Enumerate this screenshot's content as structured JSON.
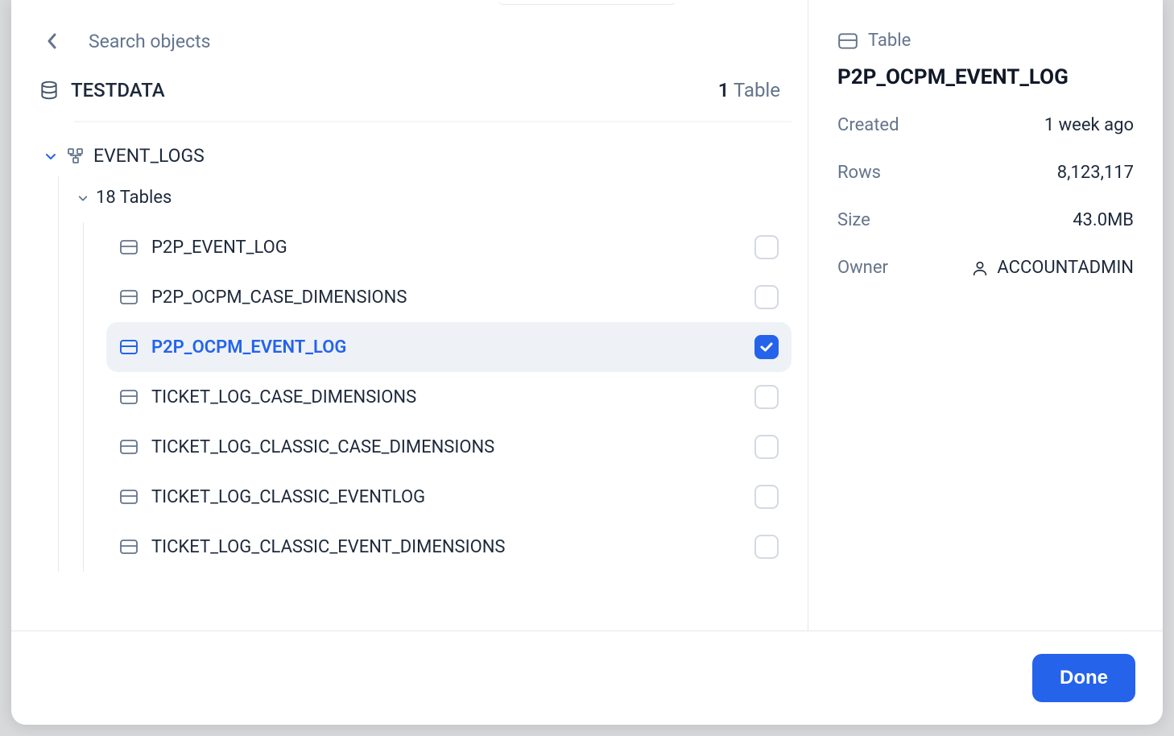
{
  "search": {
    "placeholder": "Search objects"
  },
  "database": {
    "name": "TESTDATA",
    "count_number": "1",
    "count_noun": "Table"
  },
  "schema": {
    "name": "EVENT_LOGS",
    "tables_group_label": "18 Tables"
  },
  "tables": [
    {
      "name": "P2P_EVENT_LOG",
      "selected": false,
      "checked": false
    },
    {
      "name": "P2P_OCPM_CASE_DIMENSIONS",
      "selected": false,
      "checked": false
    },
    {
      "name": "P2P_OCPM_EVENT_LOG",
      "selected": true,
      "checked": true
    },
    {
      "name": "TICKET_LOG_CASE_DIMENSIONS",
      "selected": false,
      "checked": false
    },
    {
      "name": "TICKET_LOG_CLASSIC_CASE_DIMENSIONS",
      "selected": false,
      "checked": false
    },
    {
      "name": "TICKET_LOG_CLASSIC_EVENTLOG",
      "selected": false,
      "checked": false
    },
    {
      "name": "TICKET_LOG_CLASSIC_EVENT_DIMENSIONS",
      "selected": false,
      "checked": false
    }
  ],
  "details": {
    "kind": "Table",
    "title": "P2P_OCPM_EVENT_LOG",
    "meta": {
      "created_label": "Created",
      "created_value": "1 week ago",
      "rows_label": "Rows",
      "rows_value": "8,123,117",
      "size_label": "Size",
      "size_value": "43.0MB",
      "owner_label": "Owner",
      "owner_value": "ACCOUNTADMIN"
    }
  },
  "footer": {
    "done_label": "Done"
  }
}
